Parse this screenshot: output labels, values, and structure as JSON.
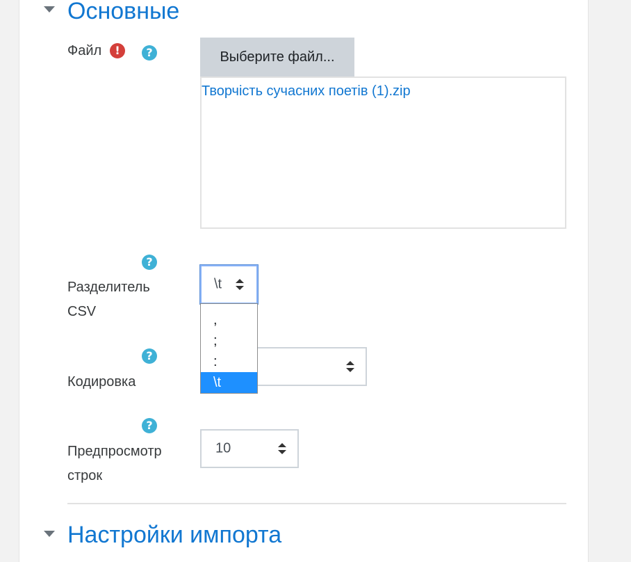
{
  "sections": {
    "general_title": "Основные",
    "import_title": "Настройки импорта"
  },
  "file_field": {
    "label": "Файл",
    "required_icon": "exclamation-icon",
    "help_icon": "question-icon",
    "choose_button": "Выберите файл...",
    "selected_file": "Творчість сучасних поетів (1).zip"
  },
  "delimiter_field": {
    "label_line1": "Разделитель",
    "label_line2": "CSV",
    "value": "\\t",
    "options": [
      ",",
      ";",
      ":",
      "\\t"
    ],
    "selected_index": 3
  },
  "encoding_field": {
    "label": "Кодировка",
    "value": ""
  },
  "preview_field": {
    "label_line1": "Предпросмотр",
    "label_line2": "строк",
    "value": "10"
  },
  "colors": {
    "accent": "#1177d1",
    "help": "#3fb1d6",
    "required": "#d43f3a",
    "selected_option": "#1e90ff"
  }
}
